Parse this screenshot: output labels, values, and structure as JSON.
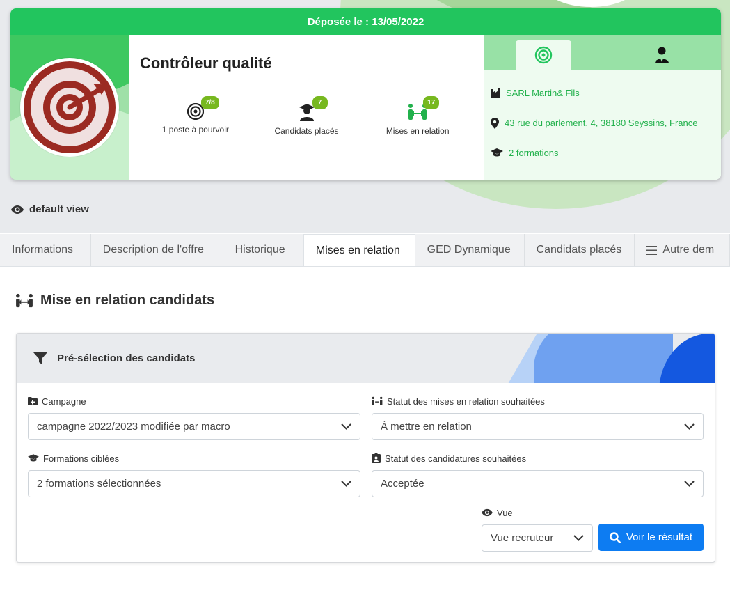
{
  "offer": {
    "posted_label": "Déposée le : 13/05/2022",
    "title": "Contrôleur qualité",
    "stats": [
      {
        "badge": "7/8",
        "label": "1 poste à pourvoir",
        "icon": "target-icon"
      },
      {
        "badge": "7",
        "label": "Candidats placés",
        "icon": "graduate-user-icon"
      },
      {
        "badge": "17",
        "label": "Mises en relation",
        "icon": "people-arrows-icon"
      }
    ],
    "company": "SARL Martin& Fils",
    "address": "43 rue du parlement, 4, 38180 Seyssins, France",
    "formations": "2 formations"
  },
  "view": {
    "label": "default view"
  },
  "tabs": [
    {
      "label": "Informations",
      "active": false
    },
    {
      "label": "Description de l'offre",
      "active": false
    },
    {
      "label": "Historique",
      "active": false
    },
    {
      "label": "Mises en relation",
      "active": true
    },
    {
      "label": "GED Dynamique",
      "active": false
    },
    {
      "label": "Candidats placés",
      "active": false
    },
    {
      "label": "Autre dem",
      "active": false
    }
  ],
  "section": {
    "title": "Mise en relation candidats"
  },
  "filters": {
    "title": "Pré-sélection des candidats",
    "campaign": {
      "label": "Campagne",
      "value": "campagne 2022/2023 modifiée par macro"
    },
    "relation_status": {
      "label": "Statut des mises en relation souhaitées",
      "value": "À mettre en relation"
    },
    "formations": {
      "label": "Formations ciblées",
      "value": "2 formations sélectionnées"
    },
    "application_status": {
      "label": "Statut des candidatures souhaitées",
      "value": "Acceptée"
    },
    "view": {
      "label": "Vue",
      "value": "Vue recruteur"
    },
    "submit_label": "Voir le résultat"
  },
  "colors": {
    "brand_green": "#22c55e",
    "badge_green": "#77b81f",
    "primary_blue": "#0d7cf2"
  }
}
